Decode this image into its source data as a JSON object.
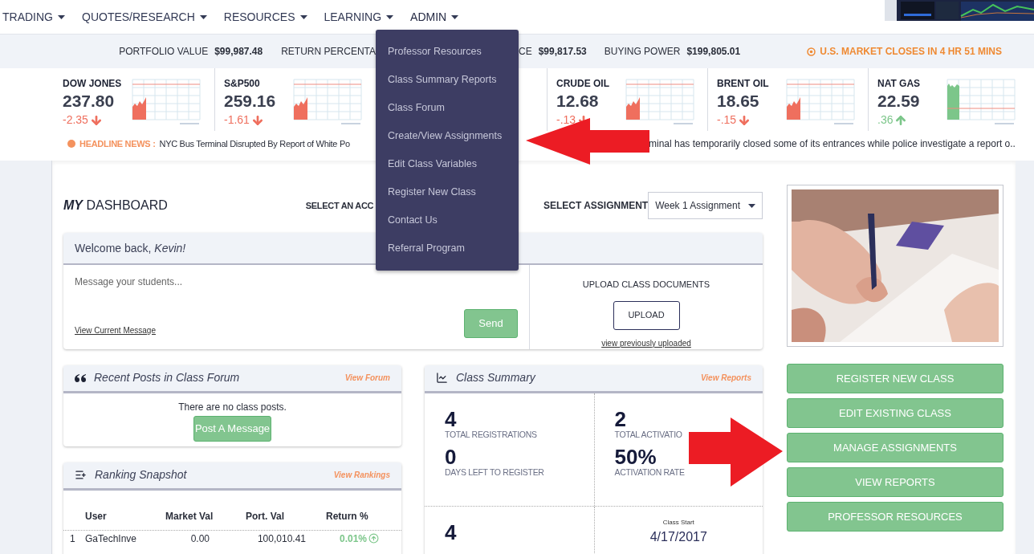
{
  "nav": {
    "items": [
      {
        "label": "TRADING",
        "expanded": false
      },
      {
        "label": "QUOTES/RESEARCH",
        "expanded": false
      },
      {
        "label": "RESOURCES",
        "expanded": false
      },
      {
        "label": "LEARNING",
        "expanded": false
      },
      {
        "label": "ADMIN",
        "expanded": true
      }
    ]
  },
  "admin_menu": {
    "items": [
      "Professor Resources",
      "Class Summary Reports",
      "Class Forum",
      "Create/View Assignments",
      "Edit Class Variables",
      "Register New Class",
      "Contact Us",
      "Referral Program"
    ]
  },
  "stats_bar": {
    "left": [
      {
        "label": "PORTFOLIO VALUE",
        "value": "$99,987.48"
      },
      {
        "label": "RETURN PERCENTA"
      }
    ],
    "right": [
      {
        "label": "CE",
        "value": "$99,817.53"
      },
      {
        "label": "BUYING POWER",
        "value": "$199,805.01"
      }
    ],
    "market_notice": "U.S. MARKET CLOSES IN 4 HR 51 MINS"
  },
  "tickers": [
    {
      "name": "DOW JONES",
      "value": "237.80",
      "change": "-2.35",
      "up": false
    },
    {
      "name": "S&P500",
      "value": "259.16",
      "change": "-1.61",
      "up": false
    },
    {
      "name": "CRUDE OIL",
      "value": "12.68",
      "change": "-.13",
      "up": false
    },
    {
      "name": "BRENT OIL",
      "value": "18.65",
      "change": "-.15",
      "up": false
    },
    {
      "name": "NAT GAS",
      "value": "22.59",
      "change": ".36",
      "up": true
    }
  ],
  "headline": {
    "label": "HEADLINE NEWS :",
    "text_before": "NYC Bus Terminal Disrupted By Report of White Po",
    "text_after": "minal has temporarily closed some of its entrances while police investigate a report o.."
  },
  "dashboard": {
    "title_bold": "MY",
    "title": "DASHBOARD",
    "account_label": "SELECT AN ACC",
    "assignment_label": "SELECT ASSIGNMENT",
    "assignment_value": "Week 1 Assignment"
  },
  "welcome": {
    "greeting": "Welcome back, *Kevin!*",
    "message_placeholder": "Message your students...",
    "view_link": "View Current Message",
    "send": "Send",
    "upload_title": "UPLOAD CLASS DOCUMENTS",
    "upload": "UPLOAD",
    "uploaded_link": "view previously uploaded"
  },
  "forum": {
    "title": "Recent Posts in Class Forum",
    "link": "View Forum",
    "empty": "There are no class posts.",
    "button": "Post A Message"
  },
  "ranking": {
    "title": "Ranking Snapshot",
    "link": "View Rankings",
    "columns": [
      "User",
      "Market Val",
      "Port. Val",
      "Return %"
    ],
    "rows": [
      {
        "rank": "1",
        "user": "GaTechInve",
        "market_val": "0.00",
        "port_val": "100,010.41",
        "return": "0.01%",
        "up": true
      }
    ]
  },
  "summary": {
    "title": "Class Summary",
    "link": "View Reports",
    "columns": [
      {
        "stats": [
          {
            "value": "4",
            "label": "TOTAL REGISTRATIONS"
          },
          {
            "value": "0",
            "label": "DAYS LEFT TO REGISTER"
          }
        ]
      },
      {
        "stats": [
          {
            "value": "2",
            "label": "TOTAL ACTIVATIO"
          },
          {
            "value": "50%",
            "label": "ACTIVATION RATE"
          }
        ]
      }
    ],
    "bottom": [
      {
        "value": "4"
      },
      {
        "caption": "Class Start",
        "value": "4/17/2017"
      }
    ]
  },
  "actions": [
    "REGISTER NEW CLASS",
    "EDIT EXISTING CLASS",
    "MANAGE ASSIGNMENTS",
    "VIEW REPORTS",
    "PROFESSOR RESOURCES"
  ]
}
